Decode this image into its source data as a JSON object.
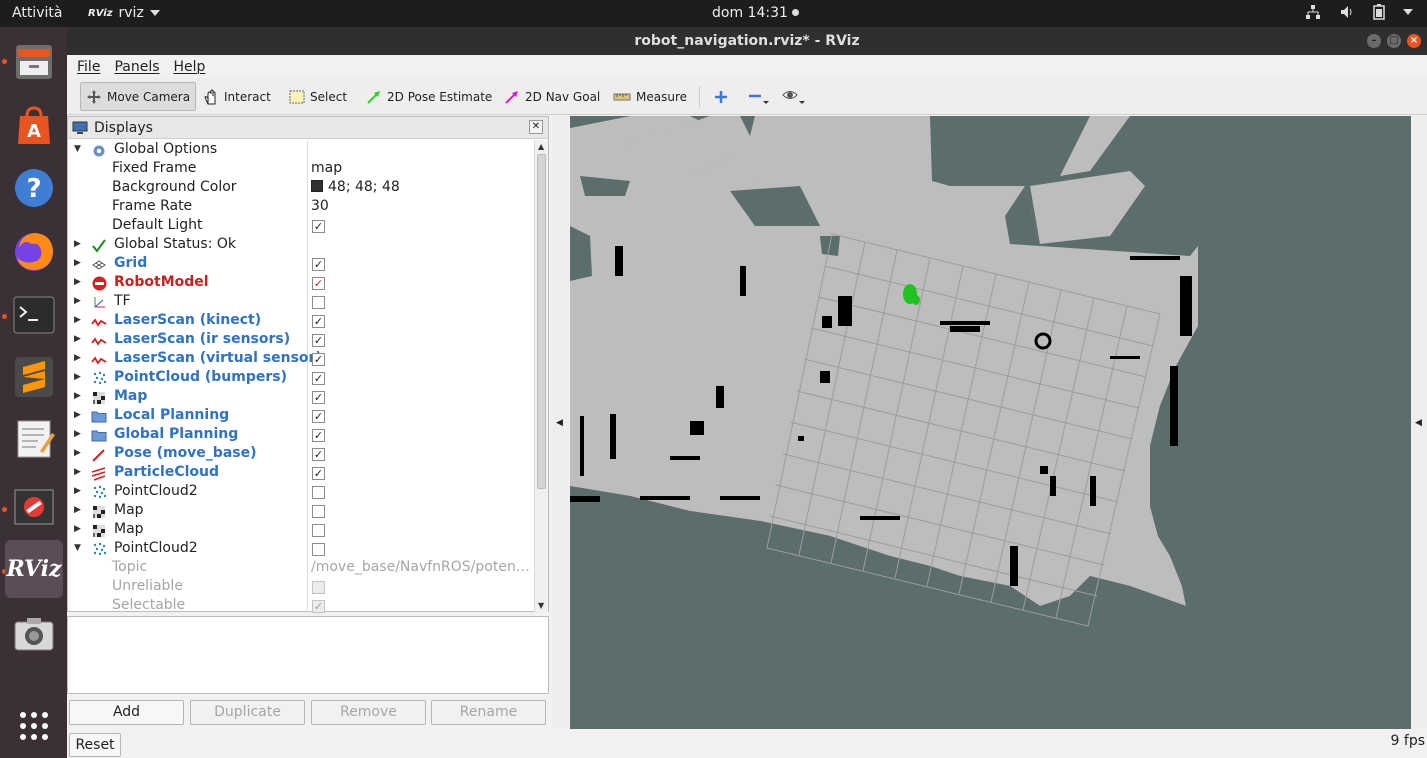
{
  "topbar": {
    "activities": "Attività",
    "app_name": "rviz",
    "app_icon_text": "RViz",
    "clock": "dom 14:31"
  },
  "dock": {
    "items": [
      "files-icon",
      "software-icon",
      "help-icon",
      "firefox-icon",
      "terminal-icon",
      "sublime-icon",
      "text-editor-icon",
      "no-entry-icon",
      "rviz-icon",
      "screenshot-icon",
      "show-apps-icon"
    ],
    "rviz_label": "RViz"
  },
  "window": {
    "title": "robot_navigation.rviz* - RViz"
  },
  "menu": {
    "file": "File",
    "panels": "Panels",
    "help": "Help"
  },
  "toolbar": {
    "move_camera": "Move Camera",
    "interact": "Interact",
    "select": "Select",
    "pose_estimate": "2D Pose Estimate",
    "nav_goal": "2D Nav Goal",
    "measure": "Measure"
  },
  "displays": {
    "title": "Displays",
    "global_options": "Global Options",
    "fixed_frame_label": "Fixed Frame",
    "fixed_frame_value": "map",
    "background_color_label": "Background Color",
    "background_color_value": "48; 48; 48",
    "frame_rate_label": "Frame Rate",
    "frame_rate_value": "30",
    "default_light_label": "Default Light",
    "global_status": "Global Status: Ok",
    "grid": "Grid",
    "robot_model": "RobotModel",
    "tf": "TF",
    "laser_kinect": "LaserScan (kinect)",
    "laser_ir": "LaserScan (ir sensors)",
    "laser_virtual": "LaserScan (virtual sensor)",
    "pointcloud_bumpers": "PointCloud (bumpers)",
    "map1": "Map",
    "local_planning": "Local Planning",
    "global_planning": "Global Planning",
    "pose_move_base": "Pose (move_base)",
    "particle_cloud": "ParticleCloud",
    "pointcloud2_a": "PointCloud2",
    "map2": "Map",
    "map3": "Map",
    "pointcloud2_b": "PointCloud2",
    "topic_label": "Topic",
    "topic_value": "/move_base/NavfnROS/poten…",
    "unreliable_label": "Unreliable",
    "selectable_label": "Selectable"
  },
  "buttons": {
    "add": "Add",
    "duplicate": "Duplicate",
    "remove": "Remove",
    "rename": "Rename",
    "reset": "Reset"
  },
  "status": {
    "fps": "9 fps"
  },
  "colors": {
    "view_bg": "#5c6e6c",
    "map_free": "#bdbdbd",
    "accent": "#e95420",
    "display_blue": "#2f72c6",
    "error_red": "#c9211e"
  }
}
